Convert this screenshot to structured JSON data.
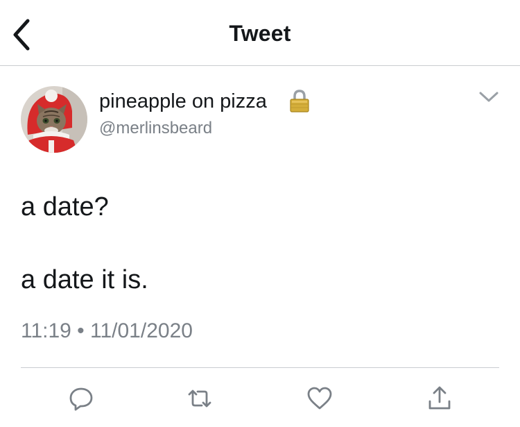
{
  "header": {
    "title": "Tweet",
    "back_icon": "chevron-left-icon"
  },
  "tweet": {
    "author": {
      "display_name": "pineapple on pizza",
      "handle": "@merlinsbeard",
      "protected_icon": "lock-icon",
      "avatar": "cat-in-santa-costume"
    },
    "text_lines": [
      "a date?",
      "a date it is."
    ],
    "time": "11:19",
    "date": "11/01/2020",
    "timestamp": "11:19 • 11/01/2020",
    "menu_icon": "chevron-down-icon"
  },
  "actions": [
    {
      "name": "reply",
      "icon": "reply-icon"
    },
    {
      "name": "retweet",
      "icon": "retweet-icon"
    },
    {
      "name": "like",
      "icon": "heart-icon"
    },
    {
      "name": "share",
      "icon": "share-icon"
    }
  ],
  "colors": {
    "text_primary": "#14171a",
    "text_secondary": "#7a8087",
    "icon_gray": "#7a8087",
    "divider": "#c9ccd0",
    "lock_gold": "#c9a227"
  }
}
